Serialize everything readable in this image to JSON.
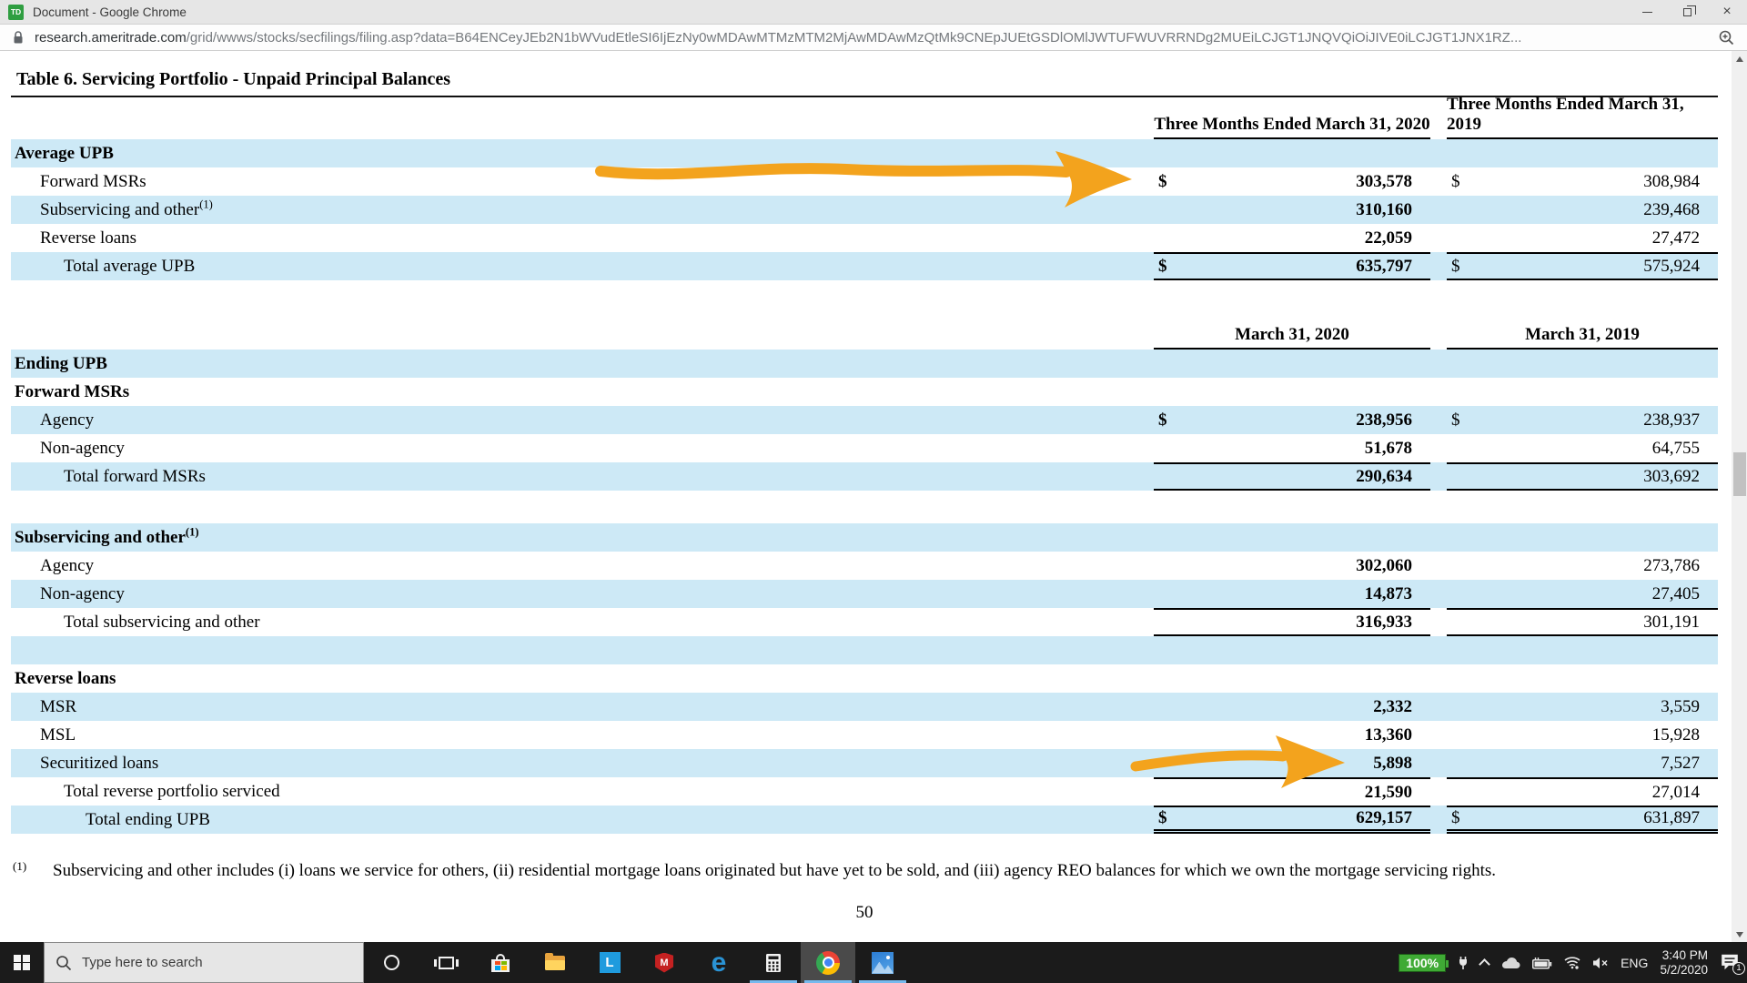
{
  "window": {
    "title": "Document - Google Chrome",
    "favicon_text": "TD",
    "close_glyph": "×"
  },
  "address_bar": {
    "url_domain": "research.ameritrade.com",
    "url_path": "/grid/wwws/stocks/secfilings/filing.asp?data=B64ENCeyJEb2N1bWVudEtleSI6IjEzNy0wMDAwMTMzMTM2MjAwMDAwMzQtMk9CNEpJUEtGSDlOMlJWTUFWUVRRNDg2MUEiLCJGT1JNQVQiOiJIVE0iLCJGT1JNX1RZ..."
  },
  "doc": {
    "title": "Table 6. Servicing Portfolio - Unpaid Principal Balances",
    "header1": {
      "col2020": "Three Months Ended March 31, 2020",
      "col2019": "Three Months Ended March 31, 2019"
    },
    "header2": {
      "col2020": "March 31, 2020",
      "col2019": "March 31, 2019"
    },
    "rows": [
      {
        "label": "Average UPB"
      },
      {
        "label": "Forward MSRs",
        "d1": "$",
        "v1": "303,578",
        "d2": "$",
        "v2": "308,984"
      },
      {
        "label": "Subservicing and other",
        "sup": "(1)",
        "v1": "310,160",
        "v2": "239,468"
      },
      {
        "label": "Reverse loans",
        "v1": "22,059",
        "v2": "27,472"
      },
      {
        "label": "Total average UPB",
        "d1": "$",
        "v1": "635,797",
        "d2": "$",
        "v2": "575,924"
      },
      {
        "label": "Ending UPB"
      },
      {
        "label": "Forward MSRs"
      },
      {
        "label": "Agency",
        "d1": "$",
        "v1": "238,956",
        "d2": "$",
        "v2": "238,937"
      },
      {
        "label": "Non-agency",
        "v1": "51,678",
        "v2": "64,755"
      },
      {
        "label": "Total forward MSRs",
        "v1": "290,634",
        "v2": "303,692"
      },
      {
        "label": "Subservicing and other",
        "sup": "(1)"
      },
      {
        "label": "Agency",
        "v1": "302,060",
        "v2": "273,786"
      },
      {
        "label": "Non-agency",
        "v1": "14,873",
        "v2": "27,405"
      },
      {
        "label": "Total subservicing and other",
        "v1": "316,933",
        "v2": "301,191"
      },
      {
        "label": ""
      },
      {
        "label": "Reverse loans"
      },
      {
        "label": "MSR",
        "v1": "2,332",
        "v2": "3,559"
      },
      {
        "label": "MSL",
        "v1": "13,360",
        "v2": "15,928"
      },
      {
        "label": "Securitized loans",
        "v1": "5,898",
        "v2": "7,527"
      },
      {
        "label": "Total reverse portfolio serviced",
        "v1": "21,590",
        "v2": "27,014"
      },
      {
        "label": "Total ending UPB",
        "d1": "$",
        "v1": "629,157",
        "d2": "$",
        "v2": "631,897"
      }
    ],
    "footnote_marker": "(1)",
    "footnote_text": "Subservicing and other includes (i) loans we service for others, (ii) residential mortgage loans originated but have yet to be sold, and (iii) agency REO balances for which we own the mortgage servicing rights.",
    "page_number": "50"
  },
  "taskbar": {
    "search_placeholder": "Type here to search",
    "l_app_letter": "L",
    "mcafee_letter": "M",
    "edge_letter": "e",
    "battery_text": "100%",
    "language": "ENG",
    "time": "3:40 PM",
    "date": "5/2/2020",
    "notification_count": "1"
  },
  "colors": {
    "row_highlight_blue": "#cde9f6",
    "annotation_arrow_orange": "#f3a31d",
    "battery_green": "#3faa35",
    "td_logo_green": "#2f9e41",
    "taskbar_bg": "#1b1b1b",
    "chrome_blue": "#4285f4"
  }
}
